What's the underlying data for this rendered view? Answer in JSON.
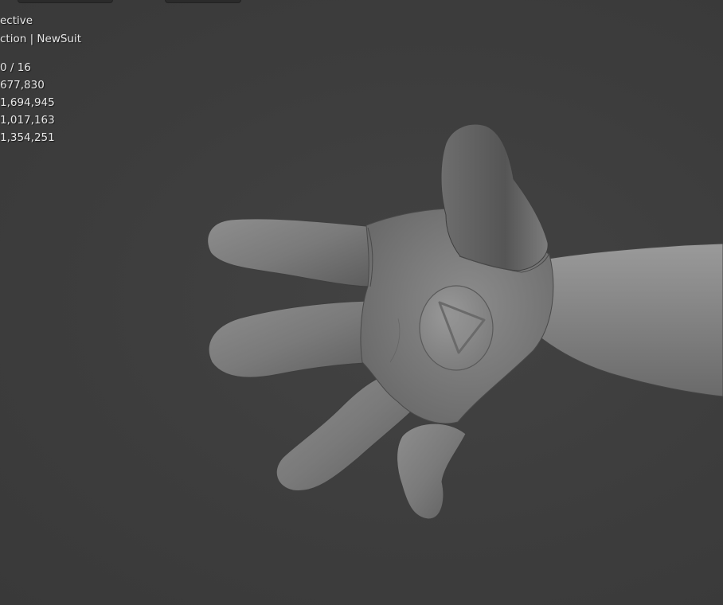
{
  "viewport": {
    "view_label": "ective",
    "collection_label": "ction | NewSuit",
    "stats": [
      "0 / 16",
      "677,830",
      "1,694,945",
      "1,017,163",
      "1,354,251"
    ]
  },
  "model": {
    "emblem_icon": "triangle-emblem-icon"
  }
}
